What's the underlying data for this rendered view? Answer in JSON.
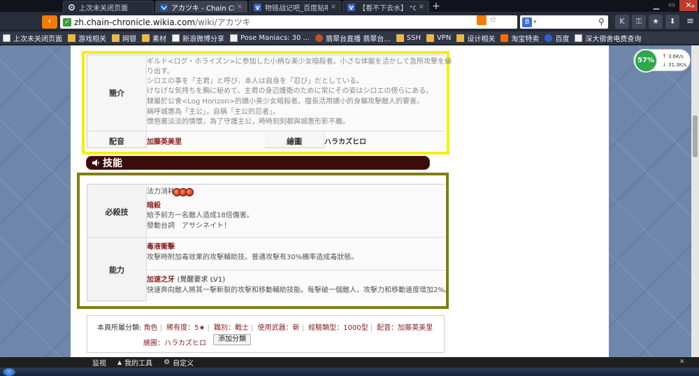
{
  "browser": {
    "tabs": [
      {
        "label": "上次未关闭页面",
        "icon": "gear-icon",
        "active": false
      },
      {
        "label": "アカツキ - Chain Ch",
        "icon": "wikia-icon",
        "active": true
      },
      {
        "label": "物链战记吧_百度贴吧",
        "icon": "tieba-icon",
        "active": false
      },
      {
        "label": "【看不下去水】 \"Ch",
        "icon": "tieba-icon",
        "active": false
      }
    ],
    "new_tab": "+",
    "url_host": "zh.chain-chronicle.wikia.com",
    "url_path": "/wiki/アカツキ",
    "search_engine_label": "8",
    "bookmarks": [
      {
        "label": "上次未关闭页面",
        "icon": "page"
      },
      {
        "label": "游戏相关",
        "icon": "folder"
      },
      {
        "label": "网银",
        "icon": "folder"
      },
      {
        "label": "素材",
        "icon": "folder"
      },
      {
        "label": "新浪微博分享",
        "icon": "page"
      },
      {
        "label": "Pose Maniacs: 30 ...",
        "icon": "page"
      },
      {
        "label": "翡翠台直播 翡翠台...",
        "icon": "fox"
      },
      {
        "label": "SSH",
        "icon": "folder"
      },
      {
        "label": "VPN",
        "icon": "folder"
      },
      {
        "label": "设计相关",
        "icon": "folder"
      },
      {
        "label": "淘宝特卖",
        "icon": "taobao"
      },
      {
        "label": "百度",
        "icon": "baidu"
      },
      {
        "label": "深大宿舍电费查询",
        "icon": "page"
      }
    ]
  },
  "speed_widget": {
    "percent": "57%",
    "up": "3.6K/s",
    "down": "31.3K/s"
  },
  "profile": {
    "intro_label": "簡介",
    "intro_lines": [
      "ギルド<ログ・ホライズン>に参加した小柄な美少女暗殺者。小さな体躯を活かして急所攻撃を繰",
      "り出す。",
      "シロエの事を「主君」と呼び、本人は自身を「忍び」だとしている。",
      "けなげな気持ちを胸に秘めて、主君の身辺護衛のために常にその姿はシロエの傍らにある。",
      "隸屬於公會<Log Horizon>的嬌小美少女暗殺者。擅長活用嬌小的身軀攻擊敵人的要害。",
      "稱呼城惠為「主公」，自稱「主公的忍者」。",
      "懷抱著淡淡的情懷，為了守護主公，時時刻刻都與城惠形影不離。"
    ],
    "voice_label": "配音",
    "voice_value": "加藤英美里",
    "art_label": "繪圖",
    "art_value": "ハラカズヒロ"
  },
  "skills_title": "技能",
  "skills": {
    "special_label": "必殺技",
    "mana_label": "法力消耗",
    "mana_orbs": 3,
    "special_name": "暗殺",
    "special_desc": "給予前方一名敵人造成18倍傷害。",
    "special_quote": "發動台詞　アサシネイト！",
    "ability_label": "能力",
    "ability1_name": "毒液衝擊",
    "ability1_desc": "攻擊時附加毒效果的攻擊輔助技。普通攻擊有30%機率造成毒狀態。",
    "ability2_name": "加速之牙",
    "ability2_req": "(覺醒要求 LV1)",
    "ability2_desc": "快速奔向敵人將其一擊斬裂的攻擊和移動輔助技能。每擊破一個敵人，攻擊力和移動速度增加2%。"
  },
  "categories": {
    "prefix": "本頁所屬分類:",
    "items": [
      "角色",
      "稀有度：5★",
      "職別：戰士",
      "使用武器：斬",
      "經驗類型：1000型",
      "配音：加藤英美里"
    ],
    "line2": "繪圖：ハラカズヒロ",
    "add_button": "添加分類"
  },
  "wikia_toolbar": {
    "items": [
      {
        "label": "监视",
        "icon": "none"
      },
      {
        "label": "我的工具",
        "icon": "chevron-up-icon"
      },
      {
        "label": "自定义",
        "icon": "gear-icon"
      }
    ]
  }
}
